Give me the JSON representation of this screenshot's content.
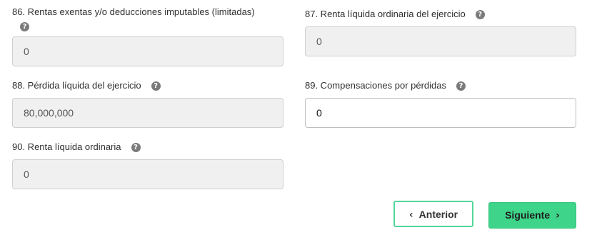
{
  "fields": {
    "f86": {
      "label": "86. Rentas exentas y/o deducciones imputables (limitadas)",
      "value": "0",
      "readonly": true
    },
    "f87": {
      "label": "87. Renta líquida ordinaria del ejercicio",
      "value": "0",
      "readonly": true
    },
    "f88": {
      "label": "88. Pérdida líquida del ejercicio",
      "value": "80,000,000",
      "readonly": true
    },
    "f89": {
      "label": "89. Compensaciones por pérdidas",
      "value": "0",
      "readonly": false
    },
    "f90": {
      "label": "90. Renta líquida ordinaria",
      "value": "0",
      "readonly": true
    }
  },
  "help_icon": {
    "glyph": "?",
    "name": "help-icon"
  },
  "nav": {
    "prev_label": "Anterior",
    "next_label": "Siguiente",
    "prev_icon": "‹",
    "next_icon": "›"
  },
  "colors": {
    "accent_green": "#3ed489",
    "accent_border": "#52d69a",
    "readonly_bg": "#f0f0f0"
  }
}
